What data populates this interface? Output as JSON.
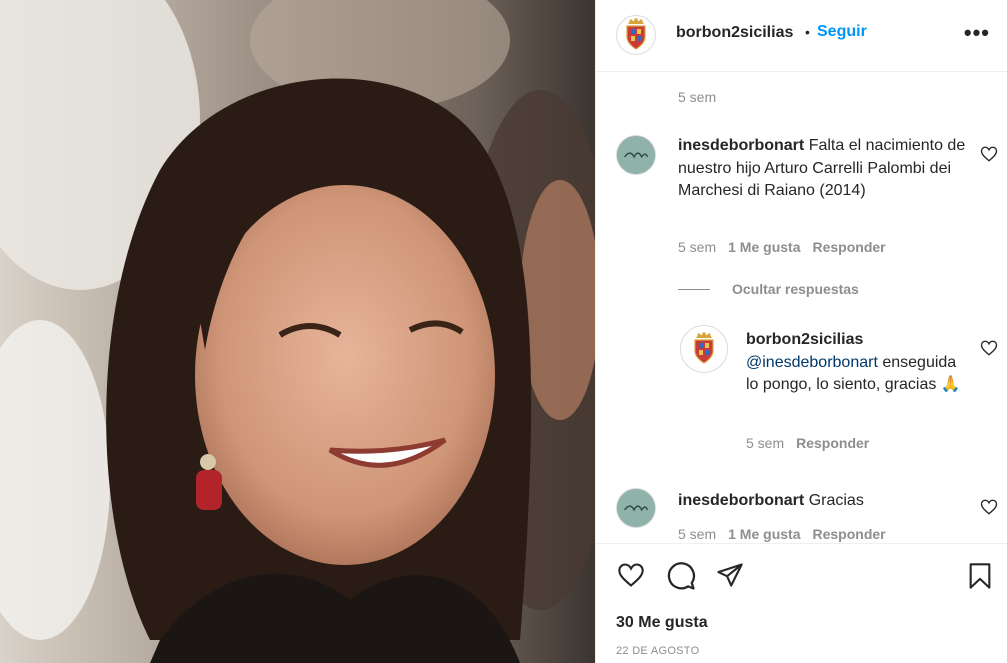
{
  "post": {
    "author": "borbon2sicilias",
    "dot": "•",
    "follow_label": "Seguir",
    "more_label": "•••"
  },
  "comments": {
    "caption_time": "5 sem",
    "items": [
      {
        "user": "inesdeborbonart",
        "text": "Falta el nacimiento de nuestro hijo Arturo Carrelli Palombi dei Marchesi di Raiano (2014)",
        "time": "5 sem",
        "likes": "1 Me gusta",
        "reply_label": "Responder"
      },
      {
        "user": "inesdeborbonart",
        "text": "Gracias",
        "time": "5 sem",
        "likes": "1 Me gusta",
        "reply_label": "Responder"
      }
    ],
    "hide_replies_label": "Ocultar respuestas",
    "reply": {
      "user": "borbon2sicilias",
      "mention": "@inesdeborbonart",
      "text": "enseguida lo pongo, lo siento, gracias 🙏",
      "time": "5 sem",
      "reply_label": "Responder"
    }
  },
  "footer": {
    "likes_count": "30 Me gusta",
    "date": "22 DE AGOSTO"
  },
  "colors": {
    "accent": "#0095f6",
    "muted": "#8e8e8e",
    "text": "#262626"
  },
  "icons": {
    "like": "heart-icon",
    "comment": "speech-bubble-icon",
    "share": "paper-plane-icon",
    "save": "bookmark-icon",
    "more": "ellipsis-icon"
  }
}
